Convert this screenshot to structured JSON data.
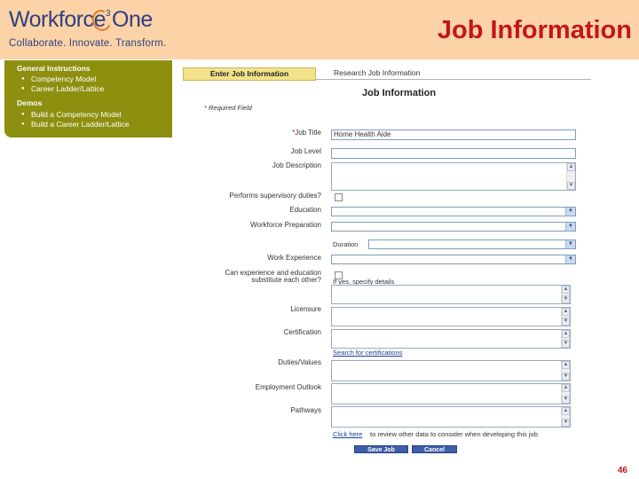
{
  "header": {
    "logo_text": "Workforc",
    "logo_e": "e",
    "logo_sup": "3",
    "logo_one": "One",
    "tagline": "Collaborate. Innovate. Transform.",
    "title": "Job Information"
  },
  "sidebar": {
    "general_heading": "General Instructions",
    "general_items": [
      "Competency Model",
      "Career Ladder/Lattice"
    ],
    "demos_heading": "Demos",
    "demo_items": [
      "Build a Competency Model",
      "Build a Career Ladder/Lattice"
    ]
  },
  "tabs": {
    "active": "Enter Job Information",
    "inactive": "Research Job Information"
  },
  "form": {
    "title": "Job Information",
    "required_note": "* Required Field",
    "job_title_label": "Job Title",
    "job_title_value": "Home Health Aide",
    "job_level_label": "Job Level",
    "job_description_label": "Job Description",
    "performs_label": "Performs supervisory duties?",
    "education_label": "Education",
    "workforce_prep_label": "Workforce Preparation",
    "duration_label": "Duration",
    "work_experience_label": "Work Experience",
    "can_experience_label_1": "Can experience and education",
    "can_experience_label_2": "substitute each other?",
    "yes_specify_label": "If yes, specify details",
    "licensure_label": "Licensure",
    "certification_label": "Certification",
    "search_certifications_link": "Search for certifications",
    "duties_label": "Duties/Values",
    "employment_outlook_label": "Employment Outlook",
    "pathways_label": "Pathways",
    "click_here_link": "Click here",
    "click_here_tail": "to review other data to consider when developing this job",
    "save_button": "Save Job",
    "cancel_button": "Cancel"
  },
  "footer": {
    "page_number": "46"
  }
}
